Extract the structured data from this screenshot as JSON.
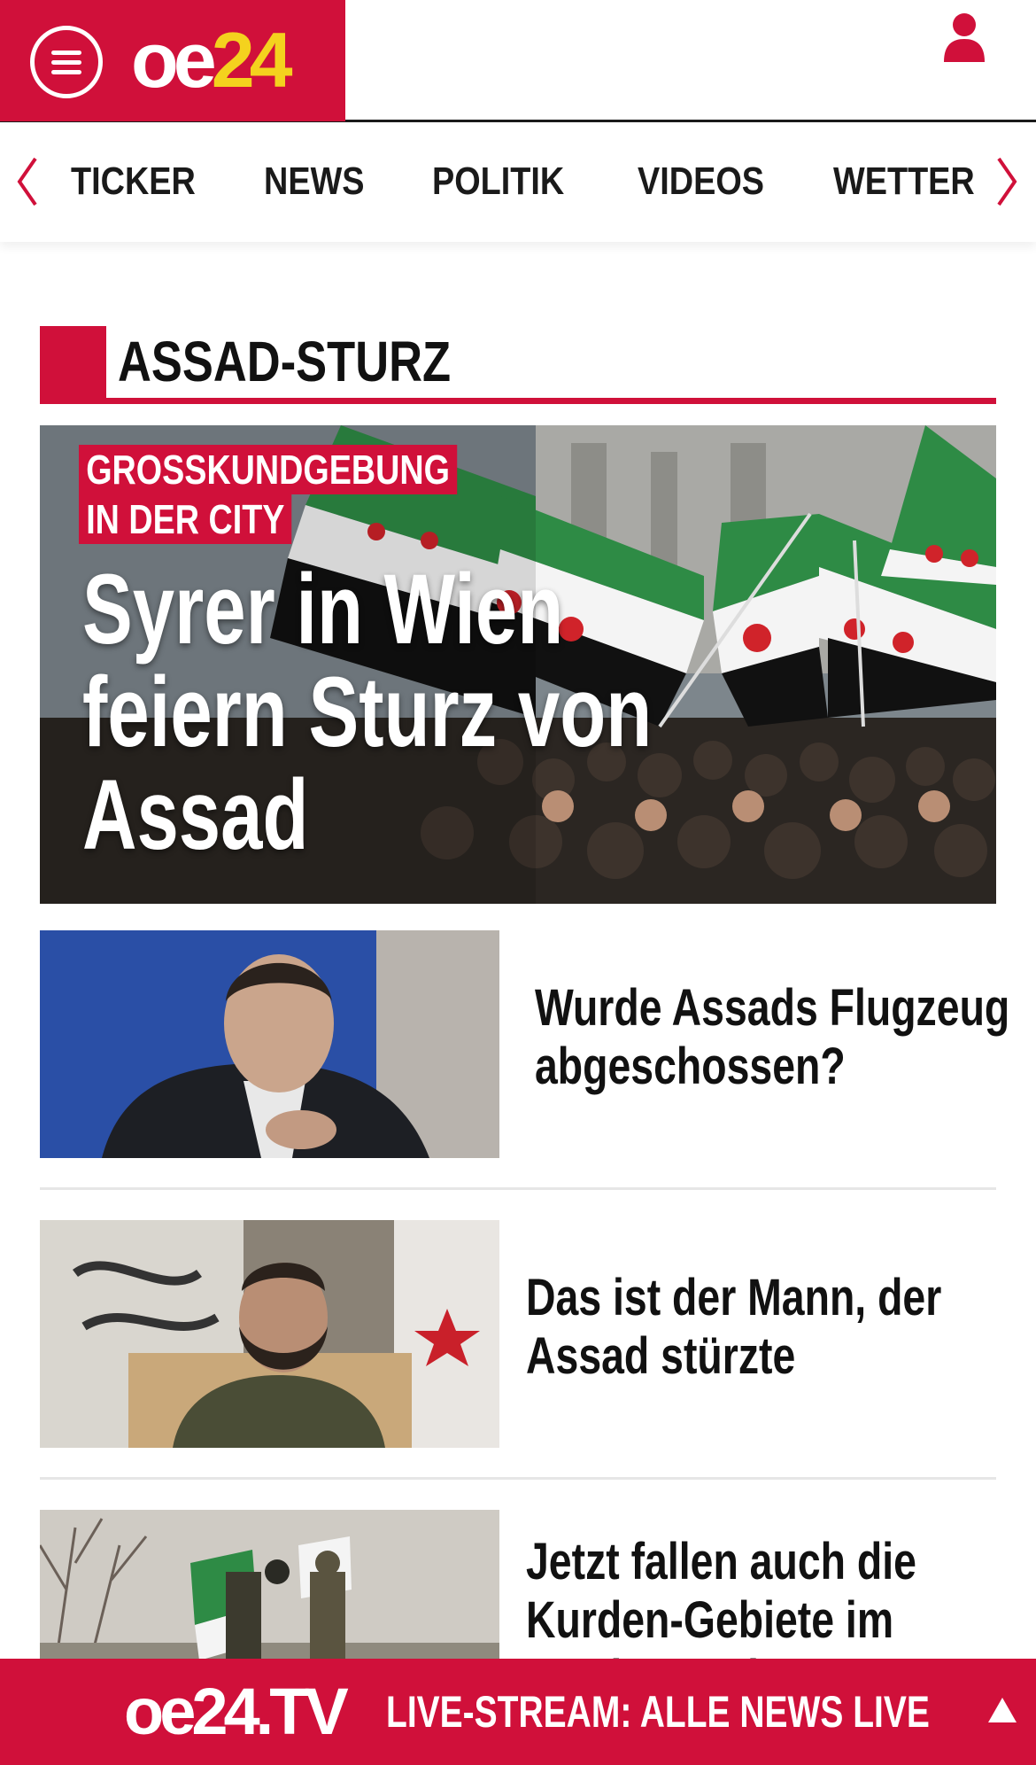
{
  "header": {
    "logo_main": "oe",
    "logo_num": "24",
    "menu_icon": "hamburger-menu-icon",
    "user_icon": "user-icon",
    "brand_color": "#d0103a",
    "logo_accent_color": "#f4d21e"
  },
  "nav": {
    "items": [
      {
        "label": "TICKER"
      },
      {
        "label": "NEWS"
      },
      {
        "label": "POLITIK"
      },
      {
        "label": "VIDEOS"
      },
      {
        "label": "WETTER"
      }
    ],
    "left_icon": "chevron-left-icon",
    "right_icon": "chevron-right-icon"
  },
  "section": {
    "title": "ASSAD-STURZ"
  },
  "hero": {
    "kicker_line1": "GROSSKUNDGEBUNG",
    "kicker_line2": "IN DER CITY",
    "headline": "Syrer in Wien feiern Sturz von Assad"
  },
  "articles": [
    {
      "title": "Wurde Assads Flugzeug abgeschossen?"
    },
    {
      "title": "Das ist der Mann, der Assad stürzte"
    },
    {
      "title": "Jetzt fallen auch die Kurden-Gebiete im Norden Syriens"
    }
  ],
  "livebar": {
    "logo": "oe24.TV",
    "text": "LIVE-STREAM:  ALLE NEWS LIVE",
    "arrow_icon": "arrow-up-icon"
  }
}
